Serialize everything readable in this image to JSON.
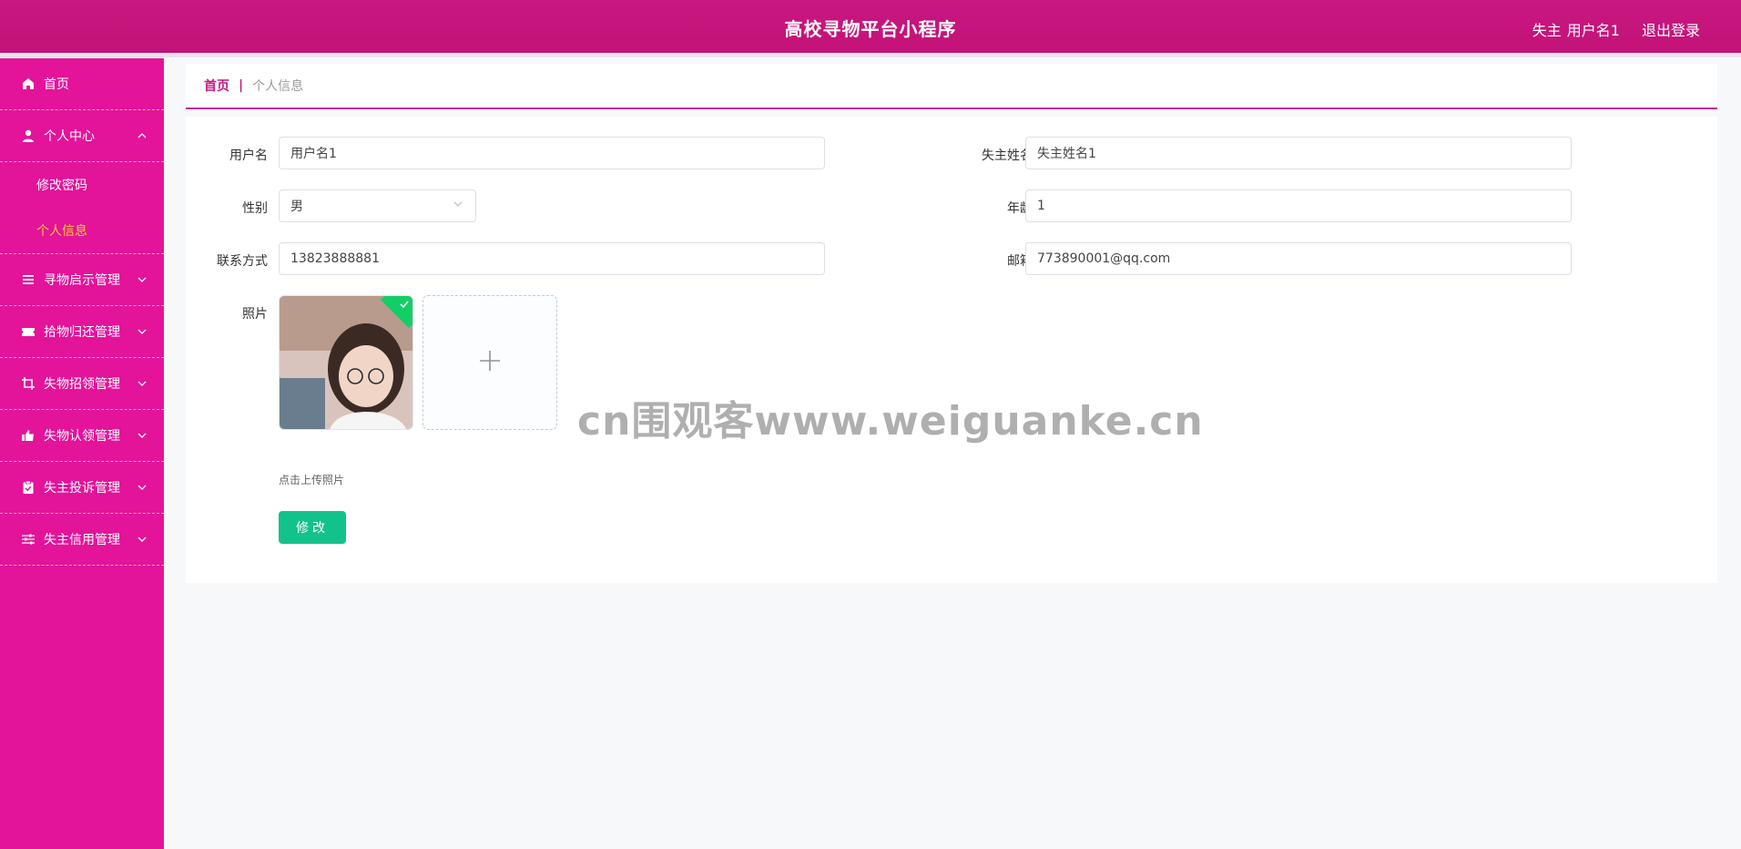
{
  "header": {
    "title": "高校寻物平台小程序",
    "role": "失主",
    "username": "用户名1",
    "logout_label": "退出登录"
  },
  "sidebar": {
    "items": [
      {
        "label": "首页",
        "icon": "home-icon"
      },
      {
        "label": "个人中心",
        "icon": "user-icon",
        "expanded": true,
        "children": [
          {
            "label": "修改密码",
            "active": false
          },
          {
            "label": "个人信息",
            "active": true
          }
        ]
      },
      {
        "label": "寻物启示管理",
        "icon": "list-icon"
      },
      {
        "label": "拾物归还管理",
        "icon": "ticket-icon"
      },
      {
        "label": "失物招领管理",
        "icon": "crop-icon"
      },
      {
        "label": "失物认领管理",
        "icon": "thumb-up-icon"
      },
      {
        "label": "失主投诉管理",
        "icon": "clipboard-check-icon"
      },
      {
        "label": "失主信用管理",
        "icon": "sliders-icon"
      }
    ]
  },
  "breadcrumb": {
    "home": "首页",
    "separator": "|",
    "current": "个人信息"
  },
  "form": {
    "username_label": "用户名",
    "username_value": "用户名1",
    "owner_name_label": "失主姓名",
    "owner_name_value": "失主姓名1",
    "gender_label": "性别",
    "gender_value": "男",
    "age_label": "年龄",
    "age_value": "1",
    "phone_label": "联系方式",
    "phone_value": "13823888881",
    "email_label": "邮箱",
    "email_value": "773890001@qq.com",
    "photo_label": "照片",
    "upload_tip": "点击上传照片",
    "submit_label": "修改"
  },
  "watermark": "cn围观客www.weiguanke.cn",
  "colors": {
    "header": "#c8177f",
    "sidebar": "#e3139a",
    "active_sub": "#ffcc33",
    "submit": "#13c28b"
  }
}
